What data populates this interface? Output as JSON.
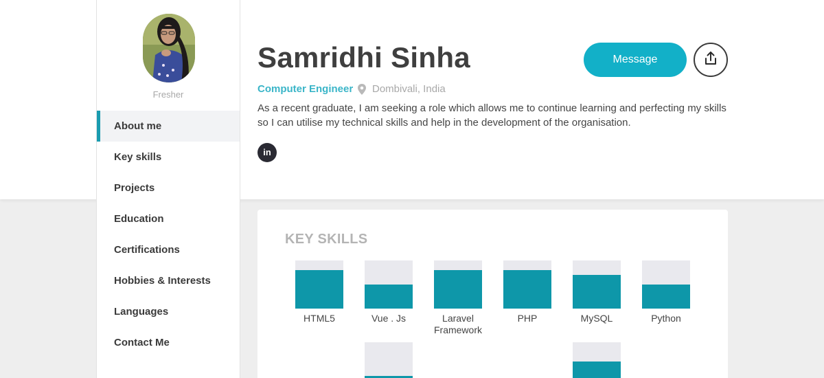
{
  "sidebar": {
    "level": "Fresher",
    "nav": [
      "About me",
      "Key skills",
      "Projects",
      "Education",
      "Certifications",
      "Hobbies & Interests",
      "Languages",
      "Contact Me"
    ],
    "active_index": 0
  },
  "profile": {
    "name": "Samridhi Sinha",
    "role": "Computer Engineer",
    "location": "Dombivali, India",
    "about": "As a recent graduate, I am seeking a role which allows me to continue learning and perfecting my skills so I can utilise my technical skills and help in the development of the organisation.",
    "linkedin_label": "in"
  },
  "actions": {
    "message_label": "Message"
  },
  "key_skills": {
    "title": "KEY SKILLS",
    "skills": [
      {
        "label": "HTML5",
        "level": 0.8
      },
      {
        "label": "Vue . Js",
        "level": 0.5
      },
      {
        "label": "Laravel Framework",
        "level": 0.8
      },
      {
        "label": "PHP",
        "level": 0.8
      },
      {
        "label": "MySQL",
        "level": 0.7
      },
      {
        "label": "Python",
        "level": 0.5
      },
      {
        "label": "",
        "level": 0.3
      },
      {
        "label": "",
        "level": 0.6
      }
    ]
  },
  "colors": {
    "accent": "#12b0c8",
    "bar_fill": "#0e97a9",
    "bar_track": "#e9e9ee",
    "active_nav_border": "#1a9cb0"
  },
  "icons": [
    "pin-icon",
    "linkedin-icon",
    "share-icon"
  ]
}
